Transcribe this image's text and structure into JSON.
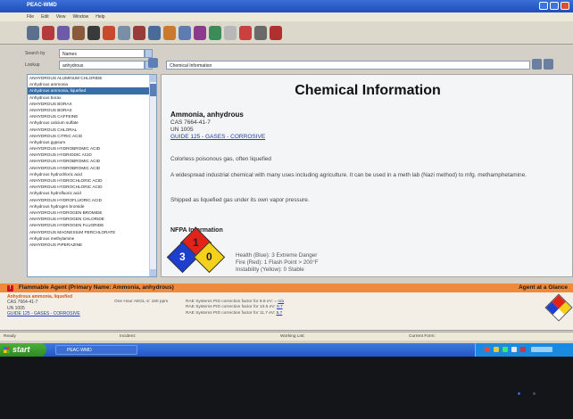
{
  "window": {
    "title": "PEAC-WMD",
    "menu": [
      "File",
      "Edit",
      "View",
      "Window",
      "Help"
    ]
  },
  "search": {
    "search_by_label": "Search by",
    "search_by_value": "Names",
    "filter_label": "Lookup",
    "filter_value": "anhydrous"
  },
  "chemical_list": {
    "items": [
      "ANHYDROUS ALUMINUM CHLORIDE",
      "Anhydrous ammonia",
      "Anhydrous ammonia, liquefied",
      "Anhydrous borax",
      "ANHYDROUS BORAX",
      "ANHYDROUS BORAX",
      "ANHYDROUS CAFFEINE",
      "Anhydrous calcium sulfate",
      "ANHYDROUS CHLORAL",
      "ANHYDROUS CITRIC ACID",
      "Anhydrous gypsum",
      "ANHYDROUS HYDROBROMIC ACID",
      "ANHYDROUS HYDRIODIC ACID",
      "ANHYDROUS HYDROBROMIC ACID",
      "ANHYDROUS HYDROBROMIC ACID",
      "Anhydrous hydrochloric acid",
      "ANHYDROUS HYDROCHLORIC ACID",
      "ANHYDROUS HYDROCHLORIC ACID",
      "Anhydrous hydrofluoric acid",
      "ANHYDROUS HYDROFLUORIC ACID",
      "Anhydrous hydrogen bromide",
      "ANHYDROUS HYDROGEN BROMIDE",
      "ANHYDROUS HYDROGEN CHLORIDE",
      "ANHYDROUS HYDROGEN FLUORIDE",
      "ANHYDROUS MAGNESIUM PERCHLORATE",
      "Anhydrous methylamine",
      "ANHYDROUS PIPERAZINE"
    ],
    "selected_index": 2
  },
  "detail": {
    "tab_label": "Chemical Information",
    "heading": "Chemical Information",
    "name": "Ammonia, anhydrous",
    "cas": "CAS 7664-41-7",
    "un": "UN 1005",
    "guide": "GUIDE  125 - GASES - CORROSIVE",
    "description_1": "Colorless poisonous gas, often liquefied",
    "description_2": "A widespread industrial chemical with many uses including agriculture. It can be used in a meth lab (Nazi method) to mfg. methamphetamine.",
    "description_3": "Shipped as liquefied gas under its own vapor pressure.",
    "nfpa_heading": "NFPA Information",
    "nfpa_health": "Health (Blue): 3 Extreme Danger",
    "nfpa_fire": "Fire (Red): 1 Flash Point > 200°F",
    "nfpa_instability": "Instability (Yellow): 0 Stable",
    "nfpa_values": {
      "health": "3",
      "fire": "1",
      "instability": "0"
    }
  },
  "alert": {
    "title": "Flammable Agent (Primary Name: Ammonia, anhydrous)",
    "right_label": "Agent at a Glance",
    "name": "Anhydrous ammonia, liquefied",
    "cas": "CAS 7664-41-7",
    "un": "UN 1005",
    "guide": "GUIDE  125 - GASES - CORROSIVE",
    "aegl": "One Hour AEGL-2:  160  ppm",
    "rae_1_label": "RAE Systems PID correction factor for 9.8 eV:  =",
    "rae_1_value": "n/a",
    "rae_2_label": "RAE Systems PID correction factor for 10.6 eV:",
    "rae_2_value": "9.7",
    "rae_3_label": "RAE Systems PID correction factor for 11.7 eV:",
    "rae_3_value": "5.7"
  },
  "status": {
    "ready": "Ready",
    "incident": "Incident:",
    "working_list": "Working List:",
    "current_form": "Current Form:"
  },
  "taskbar": {
    "start": "start",
    "task": "PEAC-WMD"
  },
  "colors": {
    "nfpa_health": "#1c3fd0",
    "nfpa_fire": "#e2231a",
    "nfpa_instability": "#f4d21c",
    "nfpa_special": "#ffffff",
    "alert_bar": "#ef8a3c",
    "list_selection": "#3a6ea5"
  }
}
